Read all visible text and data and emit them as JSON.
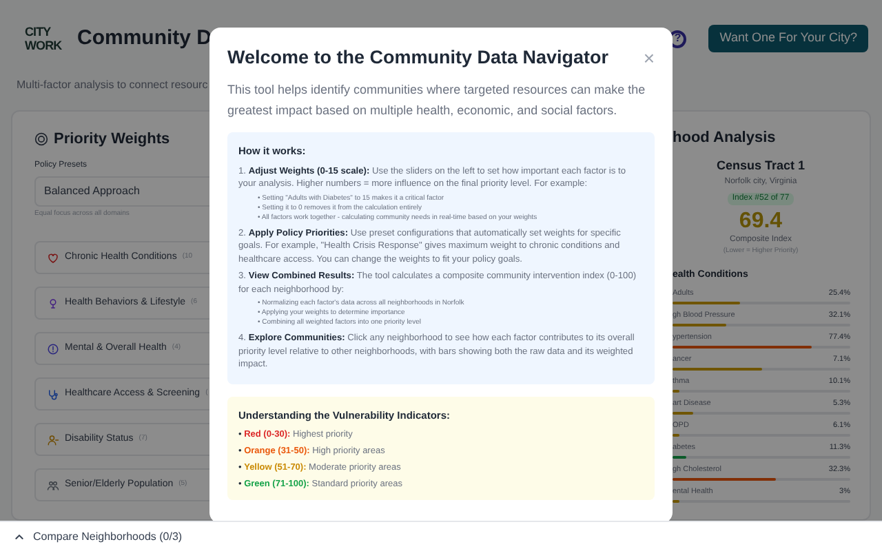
{
  "header": {
    "logo_lines": [
      "CITY",
      "WORK"
    ],
    "title": "Community D",
    "subtitle": "Multi-factor analysis to connect resourc",
    "help": "?",
    "cta": "Want One For Your City?"
  },
  "weights_panel": {
    "title": "Priority Weights",
    "preset_label": "Policy Presets",
    "preset_value": "Balanced Approach",
    "preset_hint": "Equal focus across all domains",
    "categories": [
      {
        "kind": "heart",
        "label": "Chronic Health Conditions",
        "count": "(10",
        "color": "#791515"
      },
      {
        "kind": "bulb",
        "label": "Health Behaviors & Lifestyle",
        "count": "(6",
        "color": "#442082"
      },
      {
        "kind": "info",
        "label": "Mental & Overall Health",
        "count": "(4)",
        "color": "#2b267e"
      },
      {
        "kind": "steth",
        "label": "Healthcare Access & Screening",
        "count": "(",
        "color": "#143681"
      },
      {
        "kind": "person",
        "label": "Disability Status",
        "count": "(7)",
        "color": "#6f4c02"
      },
      {
        "kind": "people",
        "label": "Senior/Elderly Population",
        "count": "(5)",
        "color": "#3b3f46"
      }
    ]
  },
  "analysis_panel": {
    "title": "hood Analysis",
    "tract": "Census Tract 1",
    "location": "Norfolk city, Virginia",
    "rank": "Index #52 of 77",
    "score": "69.4",
    "score_label": "Composite Index",
    "score_note": "(Lower = Higher Priority)",
    "section": "ealth Conditions",
    "rows": [
      {
        "label": "Adults",
        "value": "25.4%",
        "level": 0.38,
        "color": "#6f5502"
      },
      {
        "label": "gh Blood Pressure",
        "value": "32.1%",
        "level": 0.3,
        "color": "#6f5502"
      },
      {
        "label": "ypertension",
        "value": "77.4%",
        "level": 0.78,
        "color": "#813007"
      },
      {
        "label": "ancer",
        "value": "7.1%",
        "level": 0.5,
        "color": "#6f5502"
      },
      {
        "label": "thma",
        "value": "10.1%",
        "level": 0.04,
        "color": "#6f5502"
      },
      {
        "label": "art Disease",
        "value": "5.3%",
        "level": 0.12,
        "color": "#6f5502"
      },
      {
        "label": "OPD",
        "value": "6.1%",
        "level": 0.04,
        "color": "#6f5502"
      },
      {
        "label": "abetes",
        "value": "11.3%",
        "level": 0.08,
        "color": "#0c5a29"
      },
      {
        "label": "gh Cholesterol",
        "value": "32.3%",
        "level": 0.58,
        "color": "#813007"
      },
      {
        "label": "ental Health",
        "value": "3%",
        "level": 0.04,
        "color": "#6f5502"
      }
    ]
  },
  "compare_bar": {
    "label": "Compare Neighborhoods (0/3)",
    "expanded": false
  },
  "modal": {
    "title": "Welcome to the Community Data Navigator",
    "close": "×",
    "intro": "This tool helps identify communities where targeted resources can make the greatest impact based on multiple health, economic, and social factors.",
    "how_it_works": {
      "heading": "How it works:",
      "steps": [
        {
          "text": "1. **Adjust Weights (0-15 scale):** Use the sliders on the left to set how important each factor is to your analysis. Higher numbers = more influence on the final priority level. For example:",
          "bullets": [
            "• Setting \"Adults with Diabetes\" to 15 makes it a critical factor",
            "• Setting it to 0 removes it from the calculation entirely",
            "• All factors work together - calculating community needs in real-time based on your weights"
          ]
        },
        {
          "text": "2. **Apply Policy Priorities:** Use preset configurations that automatically set weights for specific goals. For example, \"Health Crisis Response\" gives maximum weight to chronic conditions and healthcare access. You can change the weights to fit your policy goals."
        },
        {
          "text": "3. **View Combined Results:** The tool calculates a composite community intervention index (0-100) for each neighborhood by:",
          "bullets": [
            "• Normalizing each factor's data across all neighborhoods in Norfolk",
            "• Applying your weights to determine importance",
            "• Combining all weighted factors into one priority level"
          ]
        },
        {
          "text": "4. **Explore Communities:** Click any neighborhood to see how each factor contributes to its overall priority level relative to other neighborhoods, with bars showing both the raw data and its weighted impact."
        }
      ]
    },
    "indicators": {
      "heading": "Understanding the Vulnerability Indicators:",
      "items": [
        {
          "bullet": "•",
          "label": "Red (0-30):",
          "text": "Highest priority",
          "color": "#dc2626"
        },
        {
          "bullet": "•",
          "label": "Orange (31-50):",
          "text": "High priority areas",
          "color": "#ea580c"
        },
        {
          "bullet": "•",
          "label": "Yellow (51-70):",
          "text": "Moderate priority areas",
          "color": "#ca8a04"
        },
        {
          "bullet": "•",
          "label": "Green (71-100):",
          "text": "Standard priority areas",
          "color": "#16a34a"
        }
      ]
    }
  }
}
